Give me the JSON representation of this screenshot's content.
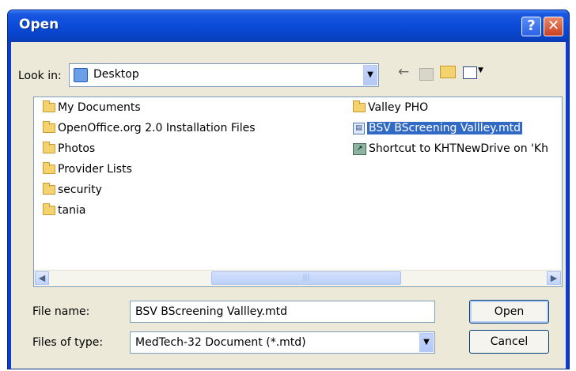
{
  "window": {
    "title": "Open"
  },
  "title_buttons": {
    "help": "?",
    "close": "✕"
  },
  "look_in": {
    "label": "Look in:",
    "value": "Desktop",
    "icon": "desktop-icon"
  },
  "toolbar": {
    "back_icon": "back-arrow-icon",
    "up_icon": "up-folder-icon",
    "new_folder_icon": "new-folder-icon",
    "views_icon": "views-menu-icon"
  },
  "files": {
    "col1": [
      {
        "label": "My Documents",
        "icon": "folder-icon"
      },
      {
        "label": "OpenOffice.org 2.0 Installation Files",
        "icon": "folder-icon"
      },
      {
        "label": "Photos",
        "icon": "folder-icon"
      },
      {
        "label": "Provider Lists",
        "icon": "folder-icon"
      },
      {
        "label": "security",
        "icon": "folder-icon"
      },
      {
        "label": "tania",
        "icon": "folder-icon"
      }
    ],
    "col2": [
      {
        "label": "Valley PHO",
        "icon": "folder-icon"
      },
      {
        "label": "BSV BScreening Vallley.mtd",
        "icon": "document-icon",
        "selected": true
      },
      {
        "label": "Shortcut to KHTNewDrive on 'Kh",
        "icon": "shortcut-icon"
      }
    ]
  },
  "file_name": {
    "label": "File name:",
    "value": "BSV BScreening Vallley.mtd"
  },
  "file_type": {
    "label": "Files of type:",
    "value": "MedTech-32 Document (*.mtd)"
  },
  "buttons": {
    "open": "Open",
    "cancel": "Cancel"
  },
  "colors": {
    "selection": "#316ac5",
    "titlebar": "#0a4bd8",
    "dialog_bg": "#ece9d8"
  }
}
